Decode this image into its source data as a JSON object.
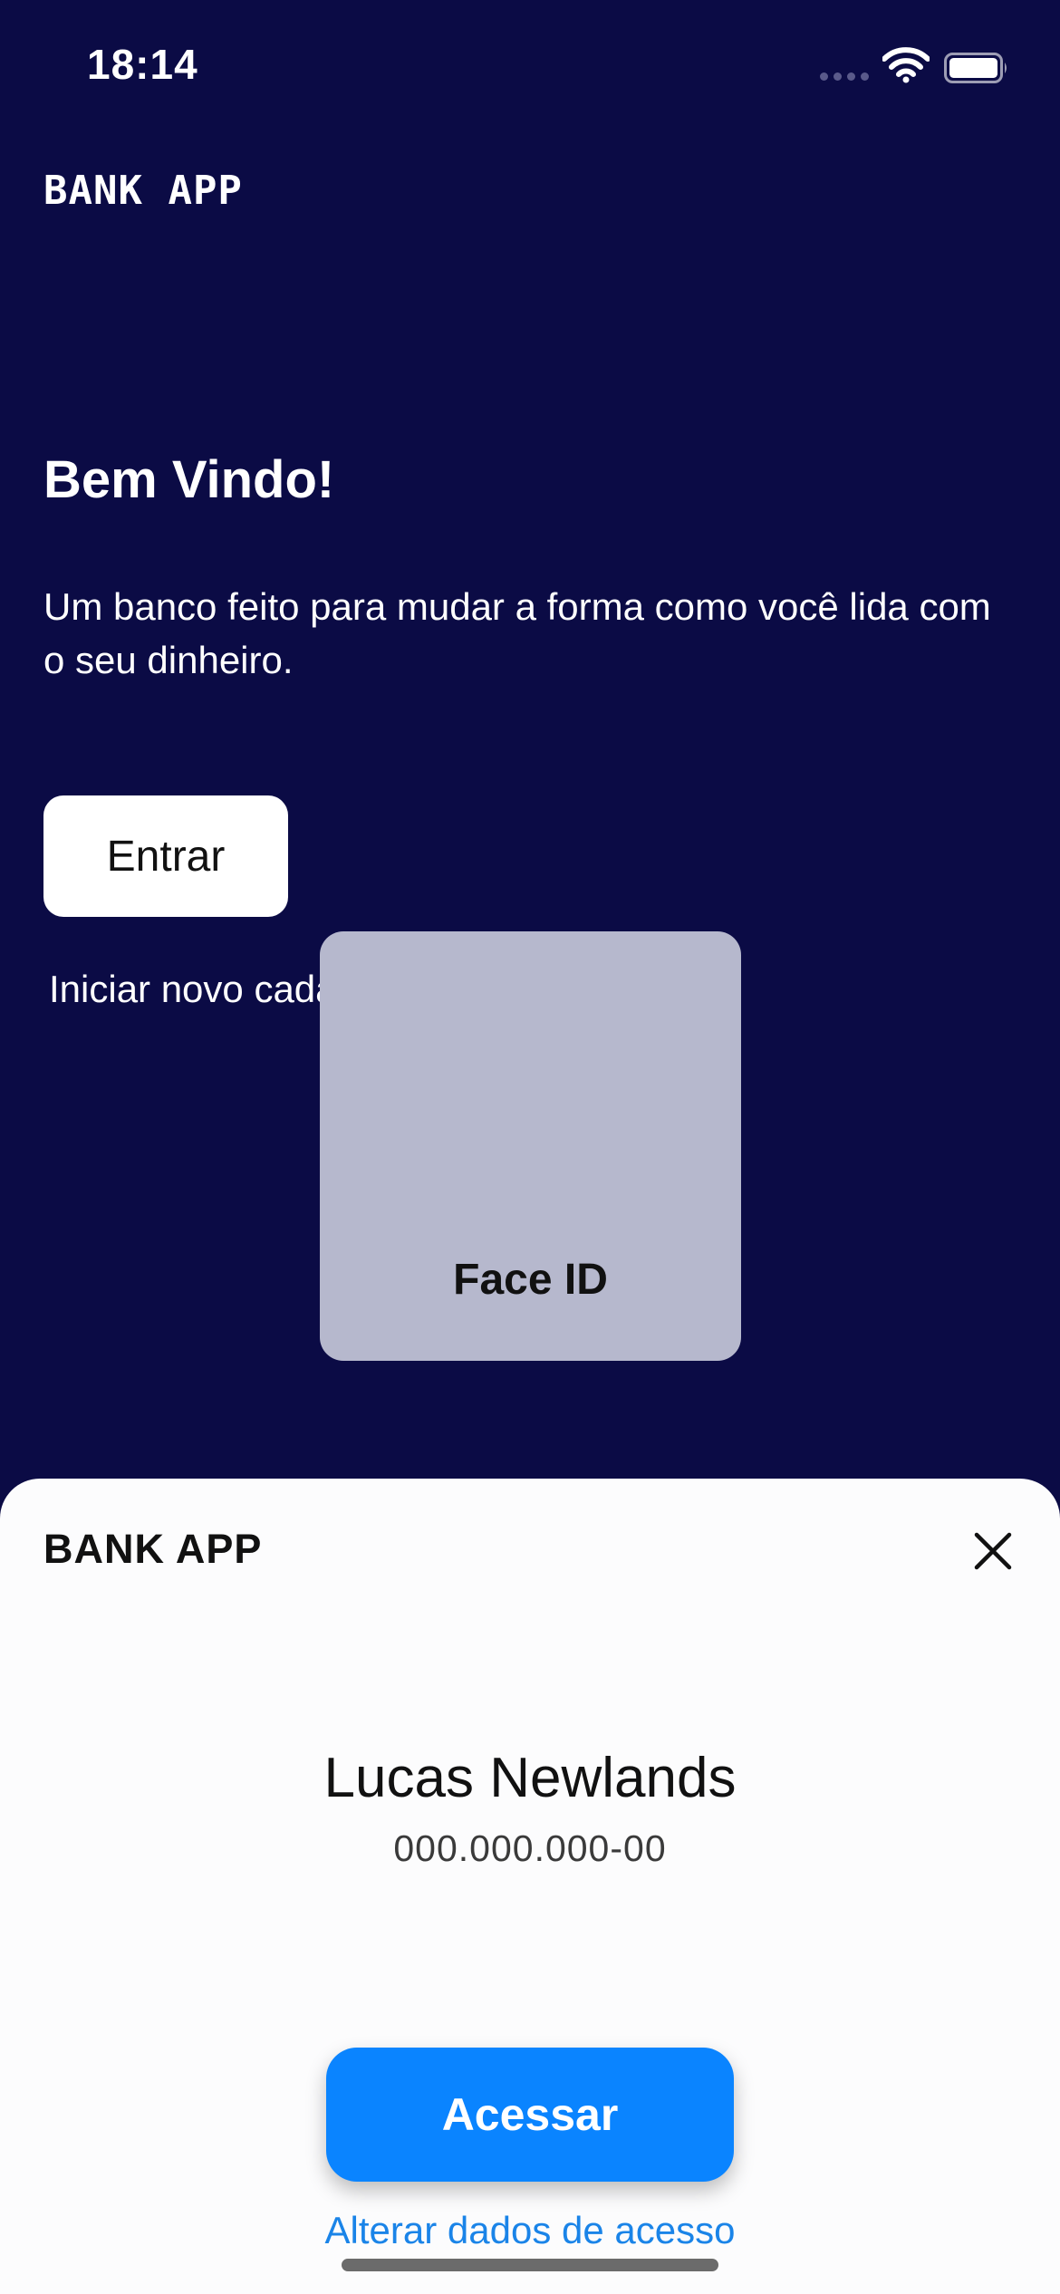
{
  "status_bar": {
    "time": "18:14",
    "icons": [
      "signal-icon",
      "wifi-icon",
      "battery-icon"
    ]
  },
  "header": {
    "brand": "BANK APP"
  },
  "welcome": {
    "title": "Bem Vindo!",
    "text": "Um banco feito para mudar a forma como você lida com o seu dinheiro."
  },
  "actions": {
    "enter_label": "Entrar",
    "new_signup_label": "Iniciar novo cadastro"
  },
  "faceid": {
    "label": "Face ID"
  },
  "sheet": {
    "title": "BANK APP",
    "user_name": "Lucas Newlands",
    "user_document": "000.000.000-00",
    "access_label": "Acessar",
    "change_access_label": "Alterar dados de acesso"
  },
  "colors": {
    "background": "#0b0b45",
    "accent": "#0a84ff",
    "link": "#1a84e8",
    "sheet": "#fcfcfd",
    "faceid_panel": "#b6b8cd"
  }
}
